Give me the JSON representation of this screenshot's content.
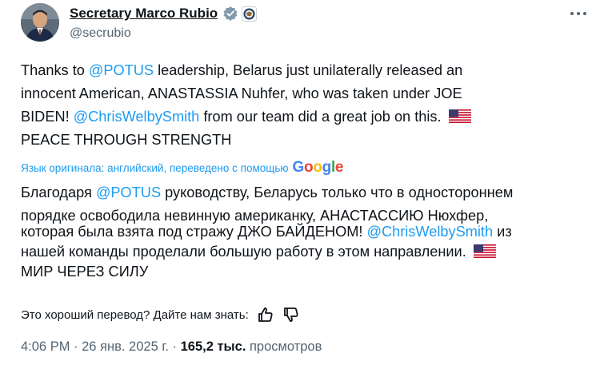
{
  "author": {
    "display_name": "Secretary Marco Rubio",
    "handle": "@secrubio"
  },
  "tweet": {
    "original": {
      "l1_a": "Thanks to ",
      "l1_mention": "@POTUS",
      "l1_b": " leadership, Belarus just unilaterally released an",
      "l2": "innocent American, ANASTASSIA Nuhfer, who was taken under JOE",
      "l3_a": "BIDEN! ",
      "l3_mention": "@ChrisWelbySmith",
      "l3_b": " from our team did a great job on this.",
      "l4": "PEACE THROUGH STRENGTH"
    },
    "translation_note": "Язык оригинала: английский, переведено с помощью",
    "translation_brand": "Google",
    "translated": {
      "l1_a": "Благодаря ",
      "l1_mention": "@POTUS",
      "l1_b": " руководству, Беларусь только что в одностороннем",
      "l2": "порядке освободила невинную американку, АНАСТАССИЮ Нюхфер,",
      "l3_a": "которая была взята под стражу ДЖО БАЙДЕНОМ! ",
      "l3_mention": "@ChrisWelbySmith",
      "l3_b": " из",
      "l4": "нашей команды проделали большую работу в этом направлении.",
      "l5": "МИР ЧЕРЕЗ СИЛУ"
    },
    "feedback_prompt": "Это хороший перевод? Дайте нам знать:",
    "time": "4:06 PM",
    "sep": " · ",
    "date": "26 янв. 2025 г.",
    "views_count": "165,2 тыс.",
    "views_label": " просмотров"
  },
  "icons": [
    "verified-badge-icon",
    "government-seal-icon",
    "more-icon",
    "us-flag-icon",
    "thumbs-up-icon",
    "thumbs-down-icon"
  ],
  "colors": {
    "link": "#1d9bf0",
    "text": "#0f1419",
    "muted": "#536471"
  }
}
